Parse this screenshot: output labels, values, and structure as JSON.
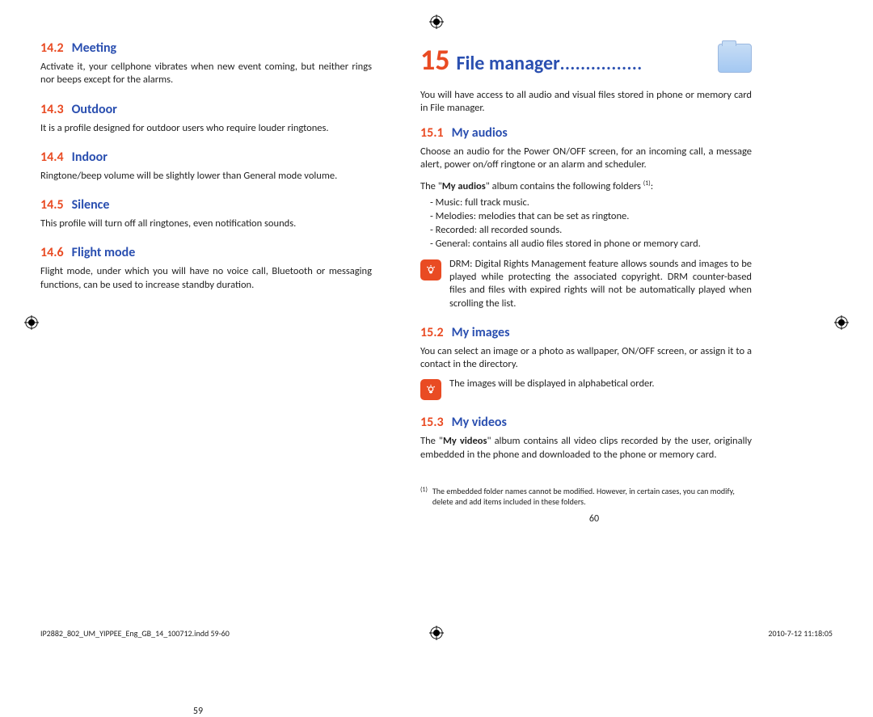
{
  "left": {
    "sections": [
      {
        "num": "14.2",
        "title": "Meeting",
        "body": "Activate it, your cellphone vibrates when new event coming, but neither rings nor beeps except for the alarms."
      },
      {
        "num": "14.3",
        "title": "Outdoor",
        "body": "It is a profile designed for outdoor users who require louder ringtones."
      },
      {
        "num": "14.4",
        "title": "Indoor",
        "body": "Ringtone/beep volume will be slightly lower than General mode volume."
      },
      {
        "num": "14.5",
        "title": "Silence",
        "body": "This profile will turn off all ringtones, even notification sounds."
      },
      {
        "num": "14.6",
        "title": "Flight mode",
        "body": "Flight mode, under which you will have no voice call, Bluetooth or messaging functions, can be used to increase standby duration."
      }
    ],
    "pageNum": "59"
  },
  "right": {
    "chapterNum": "15",
    "chapterTitle": "File manager",
    "chapterDots": "................",
    "intro": "You will have access to all audio and visual files stored in phone or memory card in File manager.",
    "sec151": {
      "num": "15.1",
      "title": "My audios",
      "p1": "Choose an audio for the Power ON/OFF screen, for an incoming call, a message alert, power on/off ringtone or an alarm and scheduler.",
      "p2a": "The \"",
      "p2b": "My audios",
      "p2c": "\" album contains the following folders ",
      "bullets": [
        "Music: full track music.",
        "Melodies: melodies that can be set as ringtone.",
        "Recorded: all recorded sounds.",
        "General: contains all audio files stored in phone or memory card."
      ],
      "note": "DRM: Digital Rights Management feature allows sounds and images to be played while protecting the associated copyright. DRM counter-based files and files with expired rights will not be automatically played when scrolling the list."
    },
    "sec152": {
      "num": "15.2",
      "title": "My images",
      "p": "You can select an image or a photo as wallpaper, ON/OFF screen, or assign it to a contact in the directory.",
      "note": "The images will be displayed in alphabetical order."
    },
    "sec153": {
      "num": "15.3",
      "title": "My videos",
      "pa": "The \"",
      "pb": "My videos",
      "pc": "\" album contains all video clips recorded by the user, originally embedded in the phone and downloaded to the phone or memory card."
    },
    "footnote": {
      "marker": "(1)",
      "text": "The embedded folder names cannot be modified. However, in certain cases, you can modify, delete and add items included in these folders."
    },
    "pageNum": "60"
  },
  "footer": {
    "file": "IP2882_802_UM_YIPPEE_Eng_GB_14_100712.indd   59-60",
    "timestamp": "2010-7-12   11:18:05"
  },
  "supRef": "(1)"
}
